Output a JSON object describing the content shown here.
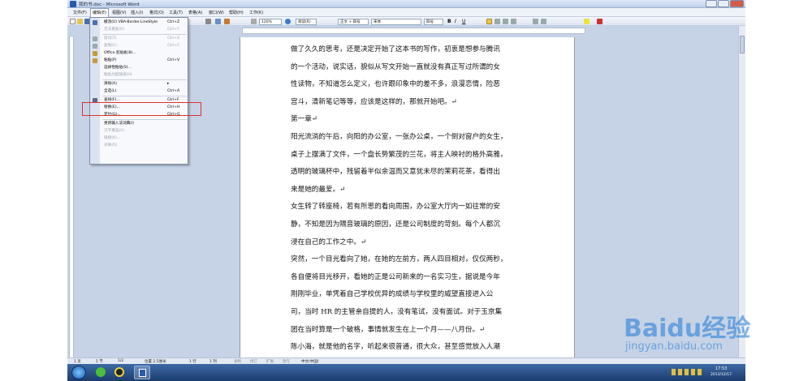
{
  "window": {
    "title": "我的书.doc - Microsoft Word"
  },
  "menus": [
    "文件(F)",
    "编辑(E)",
    "视图(V)",
    "插入(I)",
    "格式(O)",
    "工具(T)",
    "表格(A)",
    "窗口(W)",
    "帮助(H)",
    "工作(K)"
  ],
  "ask_box": "键入需要帮助的问题",
  "toolbar": {
    "zoom": "120%",
    "read_mode": "阅读(R)",
    "style": "正文 + 四号",
    "font": "宋体",
    "size": "四号",
    "bold": "B",
    "italic": "I",
    "underline": "U"
  },
  "edit_menu": {
    "items": [
      {
        "label": "撤消(U) VBA-Border.LineStyle",
        "shortcut": "Ctrl+Z",
        "disabled": false
      },
      {
        "label": "无法重复(R)",
        "shortcut": "Ctrl+Y",
        "disabled": true
      },
      {
        "label": "剪切(T)",
        "shortcut": "Ctrl+X",
        "disabled": true
      },
      {
        "label": "复制(C)",
        "shortcut": "Ctrl+C",
        "disabled": true
      },
      {
        "label": "Office 剪贴板(B)...",
        "shortcut": "",
        "disabled": false
      },
      {
        "label": "粘贴(P)",
        "shortcut": "Ctrl+V",
        "disabled": false
      },
      {
        "label": "选择性粘贴(S)...",
        "shortcut": "",
        "disabled": false
      },
      {
        "label": "粘贴为超链接(H)",
        "shortcut": "",
        "disabled": true
      },
      {
        "label": "清除(A)",
        "shortcut": "▸",
        "disabled": false
      },
      {
        "label": "全选(L)",
        "shortcut": "Ctrl+A",
        "disabled": false
      },
      {
        "label": "查找(F)...",
        "shortcut": "Ctrl+F",
        "disabled": false
      },
      {
        "label": "替换(E)...",
        "shortcut": "Ctrl+H",
        "disabled": false
      },
      {
        "label": "定位(G)...",
        "shortcut": "Ctrl+G",
        "disabled": false
      },
      {
        "label": "更新输入法词典(I)",
        "shortcut": "",
        "disabled": false
      },
      {
        "label": "汉字重选(V)",
        "shortcut": "",
        "disabled": true
      },
      {
        "label": "链接(K)...",
        "shortcut": "",
        "disabled": true
      },
      {
        "label": "对象(O)",
        "shortcut": "",
        "disabled": true
      }
    ]
  },
  "document": {
    "lines": [
      "做了久久的思考，还是决定开始了这本书的写作，初衷是想参与腾讯",
      "的一个活动，说实话，貌似从写文开始一直就没有真正写过所谓的女",
      "性读物，不知道怎么定义，也许跟印象中的差不多，浪漫恋情，险恶",
      "宫斗，清新笔记等等，应该是这样的，那就开始吧。↵",
      "第一章↵",
      "阳光流淌的午后，向阳的办公室，一张办公桌，一个倒对窗户的女生，",
      "桌子上摆满了文件，一个盘长势繁茂的兰花，将主人映衬的格外高雅，",
      "透明的玻璃杯中，残留着半似余温而又意犹未尽的茉莉花茶，看得出",
      "来是她的最爱。↵",
      "女生转了转座椅，若有所思的看向周围，办公室大厅内一如往常的安",
      "静，不知是因为隔音玻璃的原因，还是公司制度的苛刻。每个人都沉",
      "浸在自己的工作之中。↵",
      "突然，一个目光看向了她，在她的左前方，两人四目相对，仅仅两秒，",
      "各自便将目光移开，看她的正是公司新来的一名实习生，据说是今年",
      "刚刚毕业，单凭着自己学校优异的成绩与学校里的威望直接进入公",
      "司，当时 HR 的主管亲自提的人，没有笔试，没有面试。对于玉京集",
      "团在当时算是一个破格，事情就发生在上一个月——八月份。↵",
      "陈小海，就是他的名字，听起来很普通，很大众，甚至感觉放入人潮"
    ]
  },
  "status": {
    "page": "1 页",
    "section": "1 节",
    "pages": "1/2",
    "position": "位置 2.5厘米",
    "line": "1 行",
    "col": "1 列",
    "rec": "录制",
    "rev": "修订",
    "ext": "扩展",
    "ovr": "改写",
    "lang": "中文(中国)"
  },
  "tray": {
    "time": "17:53",
    "date": "2013/12/17"
  },
  "watermark": {
    "brand": "Baidu经验",
    "url": "jingyan.baidu.com"
  },
  "colors": {
    "highlight": "#e03030",
    "frame": "#c6d3e6",
    "taskbar": "#1c3c6c"
  }
}
